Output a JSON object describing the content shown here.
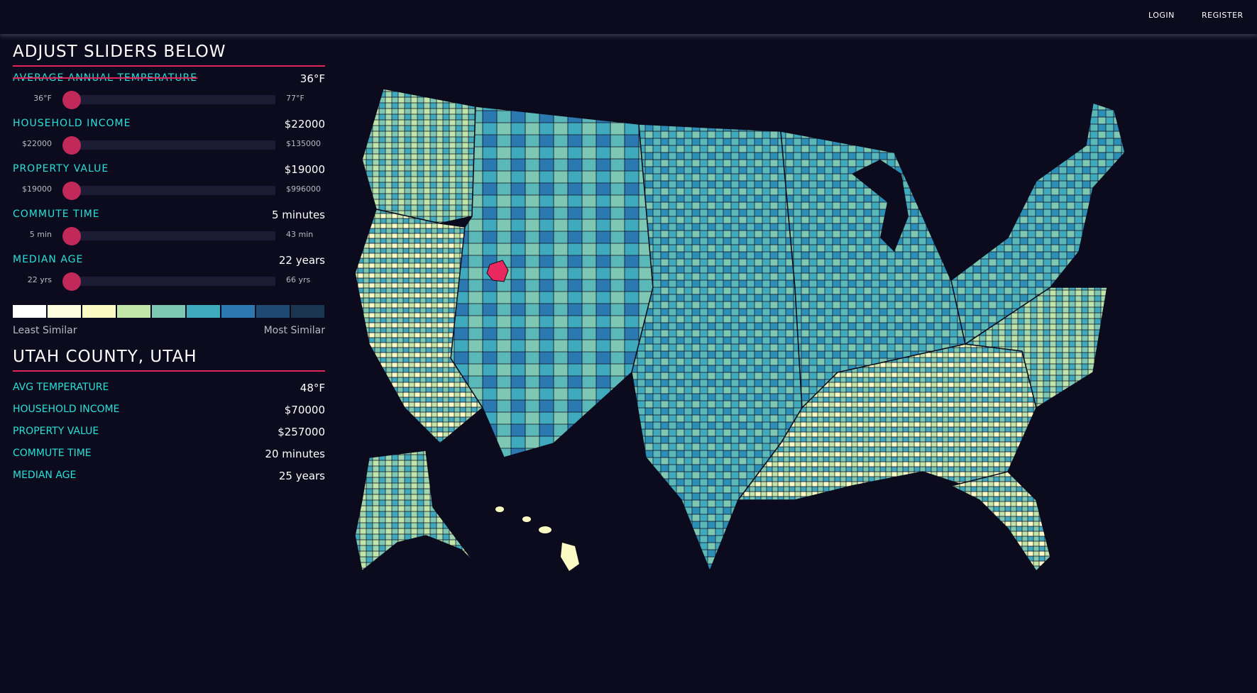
{
  "nav": {
    "login": "LOGIN",
    "register": "REGISTER"
  },
  "sliders": {
    "title": "ADJUST SLIDERS BELOW",
    "items": [
      {
        "label": "AVERAGE ANNUAL TEMPERATURE",
        "value": "36°F",
        "min": "36°F",
        "max": "77°F",
        "level": 0,
        "struck": true
      },
      {
        "label": "HOUSEHOLD INCOME",
        "value": "$22000",
        "min": "$22000",
        "max": "$135000",
        "level": 0,
        "struck": false
      },
      {
        "label": "PROPERTY VALUE",
        "value": "$19000",
        "min": "$19000",
        "max": "$996000",
        "level": 0,
        "struck": false
      },
      {
        "label": "COMMUTE TIME",
        "value": "5 minutes",
        "min": "5 min",
        "max": "43 min",
        "level": 0,
        "struck": false
      },
      {
        "label": "MEDIAN AGE",
        "value": "22 years",
        "min": "22 yrs",
        "max": "66 yrs",
        "level": 0,
        "struck": false
      }
    ]
  },
  "legend": {
    "colors": [
      "#ffffff",
      "#fffde0",
      "#fbfac5",
      "#c2e5a9",
      "#7ec8b3",
      "#3fa9bd",
      "#2c78b1",
      "#1e4a72",
      "#1b3650"
    ],
    "least_label": "Least Similar",
    "most_label": "Most Similar"
  },
  "county": {
    "title": "UTAH COUNTY, UTAH",
    "stats": [
      {
        "label": "AVG TEMPERATURE",
        "value": "48°F"
      },
      {
        "label": "HOUSEHOLD INCOME",
        "value": "$70000"
      },
      {
        "label": "PROPERTY VALUE",
        "value": "$257000"
      },
      {
        "label": "COMMUTE TIME",
        "value": "20 minutes"
      },
      {
        "label": "MEDIAN AGE",
        "value": "25 years"
      }
    ]
  },
  "map": {
    "selected_color": "#e8285f",
    "border_color": "#0b0b1d"
  }
}
